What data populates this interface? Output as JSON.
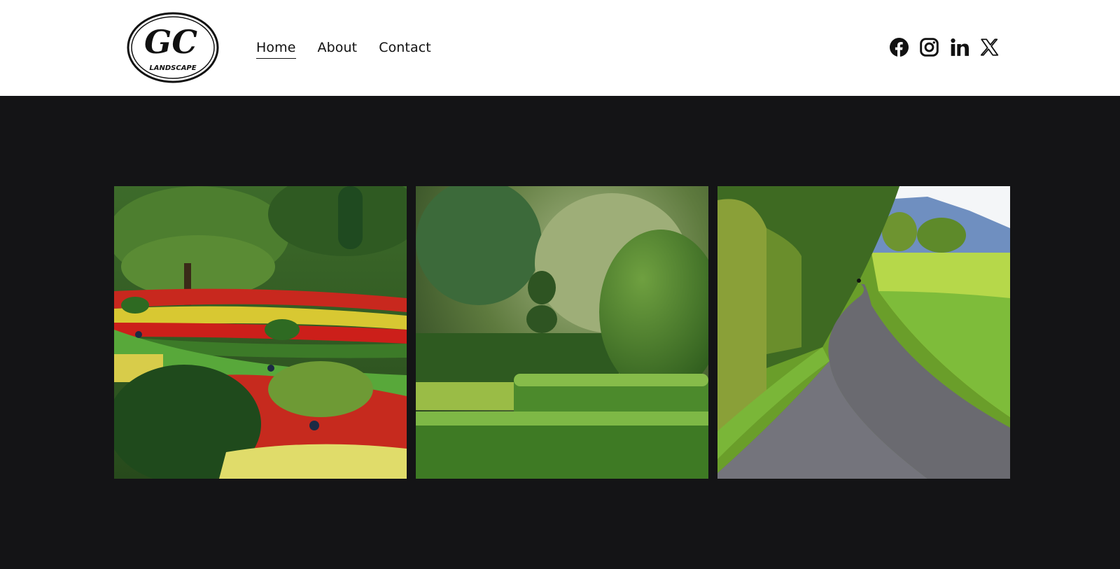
{
  "brand": {
    "logo_text_main": "GC",
    "logo_text_sub": "LANDSCAPE"
  },
  "nav": {
    "items": [
      {
        "label": "Home",
        "active": true
      },
      {
        "label": "About",
        "active": false
      },
      {
        "label": "Contact",
        "active": false
      }
    ]
  },
  "social": {
    "icons": [
      "facebook-icon",
      "instagram-icon",
      "linkedin-icon",
      "x-icon"
    ]
  },
  "gallery": {
    "images": [
      "flower-garden-photo",
      "topiary-hedge-photo",
      "garden-path-photo"
    ]
  },
  "colors": {
    "header_bg": "#ffffff",
    "page_bg": "#141416",
    "text": "#111111"
  }
}
